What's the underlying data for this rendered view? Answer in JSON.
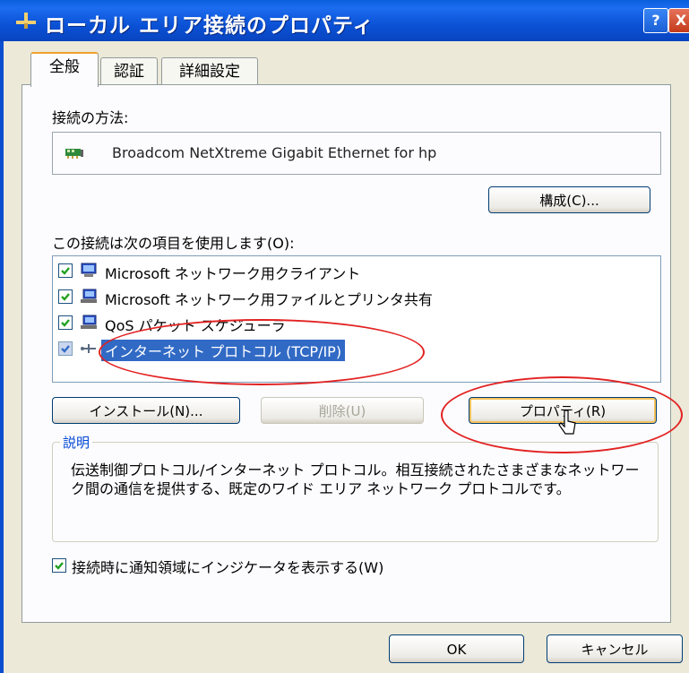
{
  "window": {
    "title": "ローカル エリア接続のプロパティ",
    "help_button": "?",
    "close_button": "X"
  },
  "tabs": [
    {
      "label": "全般",
      "active": true
    },
    {
      "label": "認証",
      "active": false
    },
    {
      "label": "詳細設定",
      "active": false
    }
  ],
  "connect_using": {
    "label": "接続の方法:",
    "adapter": "Broadcom NetXtreme Gigabit Ethernet for hp",
    "configure_button": "構成(C)..."
  },
  "items_section": {
    "label": "この接続は次の項目を使用します(O):",
    "items": [
      {
        "label": "Microsoft ネットワーク用クライアント",
        "checked": true,
        "icon": "client-icon"
      },
      {
        "label": "Microsoft ネットワーク用ファイルとプリンタ共有",
        "checked": true,
        "icon": "share-icon"
      },
      {
        "label": "QoS パケット スケジューラ",
        "checked": true,
        "icon": "qos-icon"
      },
      {
        "label": "インターネット プロトコル (TCP/IP)",
        "checked": true,
        "selected": true,
        "icon": "protocol-icon"
      }
    ]
  },
  "buttons": {
    "install": "インストール(N)...",
    "uninstall": "削除(U)",
    "properties": "プロパティ(R)",
    "ok": "OK",
    "cancel": "キャンセル"
  },
  "description": {
    "title": "説明",
    "text": "伝送制御プロトコル/インターネット プロトコル。相互接続されたさまざまなネットワーク間の通信を提供する、既定のワイド エリア ネットワーク プロトコルです。"
  },
  "notify_checkbox": {
    "label": "接続時に通知領域にインジケータを表示する(W)",
    "checked": true
  },
  "colors": {
    "titlebar": "#0a5fdc",
    "highlight_ellipse": "#e22222",
    "selection": "#316ac5"
  }
}
